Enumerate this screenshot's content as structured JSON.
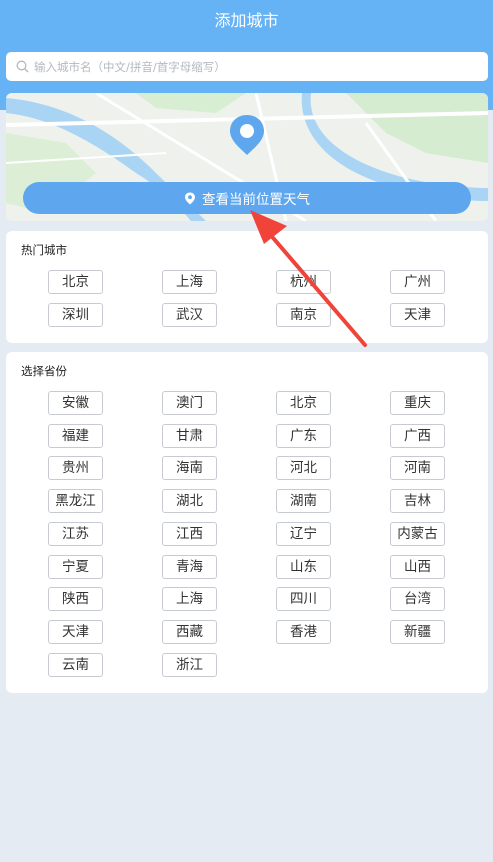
{
  "header": {
    "title": "添加城市"
  },
  "search": {
    "placeholder": "输入城市名（中文/拼音/首字母缩写）",
    "icon": "search-icon"
  },
  "map": {
    "pin_icon": "map-pin-icon",
    "location_button_label": "查看当前位置天气",
    "location_icon": "location-icon"
  },
  "hot_cities": {
    "title": "热门城市",
    "items": [
      "北京",
      "上海",
      "杭州",
      "广州",
      "深圳",
      "武汉",
      "南京",
      "天津"
    ]
  },
  "provinces": {
    "title": "选择省份",
    "items": [
      "安徽",
      "澳门",
      "北京",
      "重庆",
      "福建",
      "甘肃",
      "广东",
      "广西",
      "贵州",
      "海南",
      "河北",
      "河南",
      "黑龙江",
      "湖北",
      "湖南",
      "吉林",
      "江苏",
      "江西",
      "辽宁",
      "内蒙古",
      "宁夏",
      "青海",
      "山东",
      "山西",
      "陕西",
      "上海",
      "四川",
      "台湾",
      "天津",
      "西藏",
      "香港",
      "新疆",
      "云南",
      "浙江"
    ]
  },
  "colors": {
    "accent": "#65b3f4",
    "button": "#5ea7ee",
    "annotation_arrow": "#f0443a"
  }
}
